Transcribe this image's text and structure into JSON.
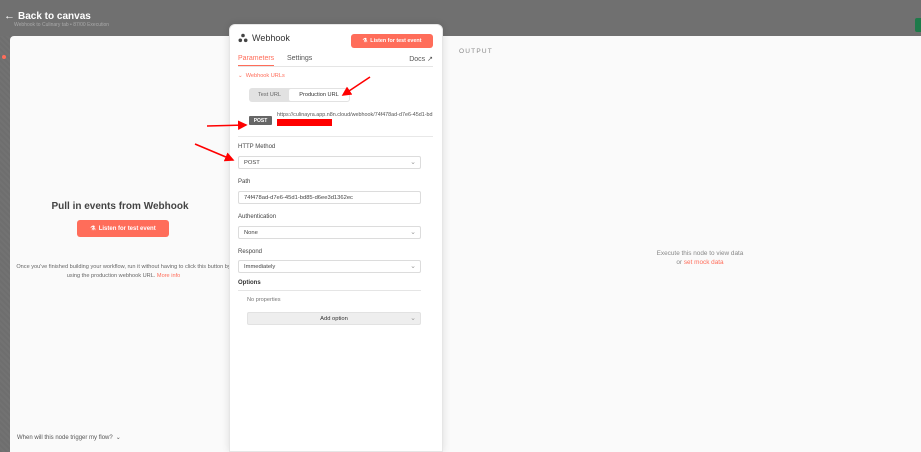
{
  "canvas": {
    "back_label": "Back to canvas",
    "ghost_breadcrumb": "Webhook to Culinary tab • 87/00 Execution"
  },
  "input_pane": {
    "title": "Pull in events from Webhook",
    "listen_button": "Listen for test event",
    "help_text": "Once you've finished building your workflow, run it without having to click this button by using the production webhook URL.",
    "more_info": "More info",
    "trigger_question": "When will this node trigger my flow?"
  },
  "node_panel": {
    "title": "Webhook",
    "listen_button": "Listen for test event",
    "tabs": [
      "Parameters",
      "Settings"
    ],
    "active_tab": "Parameters",
    "docs_label": "Docs",
    "webhook_urls": {
      "section_title": "Webhook URLs",
      "switch": [
        "Test URL",
        "Production URL"
      ],
      "selected": "Production URL",
      "method_badge": "POST",
      "url_visible": "https://culinayra.app.n8n.cloud/webhook/74f478ad-d7e6-45d1-bd"
    },
    "fields": {
      "http_method": {
        "label": "HTTP Method",
        "value": "POST"
      },
      "path": {
        "label": "Path",
        "value": "74f478ad-d7e6-45d1-bd85-d6ee3d1362ec"
      },
      "authentication": {
        "label": "Authentication",
        "value": "None"
      },
      "respond": {
        "label": "Respond",
        "value": "Immediately"
      }
    },
    "options": {
      "label": "Options",
      "empty_text": "No properties",
      "add_button": "Add option"
    }
  },
  "output_pane": {
    "label": "OUTPUT",
    "execute_text": "Execute this node to view data",
    "or_text": "or",
    "mock_link": "set mock data"
  },
  "colors": {
    "accent": "#ff6d5a",
    "annotation": "#ff0000"
  }
}
